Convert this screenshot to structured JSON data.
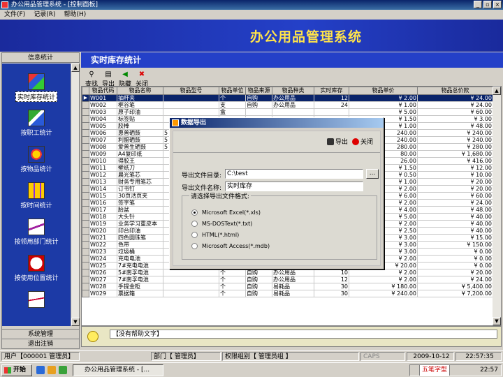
{
  "window": {
    "title": "办公用品管理系统 - [控制面板]"
  },
  "menu": [
    {
      "label": "文件(F)"
    },
    {
      "label": "记录(R)"
    },
    {
      "label": "帮助(H)"
    }
  ],
  "banner": {
    "title": "办公用品管理系统"
  },
  "sidebar": {
    "header": "信息统计",
    "items": [
      {
        "label": "实时库存统计",
        "icon": "cubes-icon",
        "selected": true
      },
      {
        "label": "按职工统计",
        "icon": "boxes-icon"
      },
      {
        "label": "按物品统计",
        "icon": "gears-icon"
      },
      {
        "label": "按时间统计",
        "icon": "grid-icon"
      },
      {
        "label": "按领用部门统计",
        "icon": "trend-chart-icon"
      },
      {
        "label": "按使用位置统计",
        "icon": "clock-icon"
      },
      {
        "label": "",
        "icon": "line-chart-icon"
      }
    ],
    "footer_system": "系统管理",
    "footer_logout": "退出注销"
  },
  "content": {
    "title": "实时库存统计",
    "toolbar": [
      {
        "label": "查找",
        "icon": "binoculars-icon"
      },
      {
        "label": "导出",
        "icon": "export-icon"
      },
      {
        "label": "隐藏",
        "icon": "arrow-left-icon"
      },
      {
        "label": "关闭",
        "icon": "close-icon"
      }
    ],
    "columns": [
      "物品代码",
      "物品名称",
      "物品型号",
      "物品单位",
      "物品来源",
      "物品种类",
      "实时库存",
      "物品单价",
      "物品总价款"
    ],
    "rows": [
      [
        "W001",
        "抽杆夹",
        "",
        "个",
        "自购",
        "办公用品",
        "12",
        "¥ 2.00",
        "¥ 24.00"
      ],
      [
        "W002",
        "框谷笔",
        "",
        "支",
        "自购",
        "办公用品",
        "24",
        "¥ 1.00",
        "¥ 24.00"
      ],
      [
        "W003",
        "原子印油",
        "",
        "盒",
        "",
        "",
        "",
        "¥ 5.00",
        "¥ 60.00"
      ],
      [
        "W004",
        "标签贴",
        "",
        "",
        "",
        "",
        "",
        "¥ 1.50",
        "¥ 3.00"
      ],
      [
        "W005",
        "胶棒",
        "",
        "",
        "",
        "",
        "",
        "¥ 1.00",
        "¥ 48.00"
      ],
      [
        "W006",
        "惠普硒鼓",
        "5",
        "",
        "",
        "",
        "",
        "240.00",
        "¥ 240.00"
      ],
      [
        "W007",
        "利盟硒鼓",
        "5",
        "",
        "",
        "",
        "",
        "240.00",
        "¥ 240.00"
      ],
      [
        "W008",
        "爱普生硒鼓",
        "5",
        "",
        "",
        "",
        "",
        "280.00",
        "¥ 280.00"
      ],
      [
        "W009",
        "A4复印纸",
        "",
        "",
        "",
        "",
        "",
        "80.00",
        "¥ 1,680.00"
      ],
      [
        "W010",
        "得胶王",
        "",
        "",
        "",
        "",
        "",
        "26.00",
        "¥ 416.00"
      ],
      [
        "W011",
        "壁纸刀",
        "",
        "",
        "",
        "",
        "",
        "¥ 1.50",
        "¥ 12.00"
      ],
      [
        "W012",
        "晨光笔芯",
        "",
        "",
        "",
        "",
        "",
        "¥ 0.50",
        "¥ 10.00"
      ],
      [
        "W013",
        "财务专用笔芯",
        "",
        "",
        "",
        "",
        "",
        "¥ 1.00",
        "¥ 20.00"
      ],
      [
        "W014",
        "订书钉",
        "",
        "",
        "",
        "",
        "",
        "¥ 2.00",
        "¥ 20.00"
      ],
      [
        "W015",
        "30页活页夹",
        "",
        "",
        "",
        "",
        "",
        "¥ 6.00",
        "¥ 60.00"
      ],
      [
        "W016",
        "签字笔",
        "",
        "",
        "",
        "",
        "",
        "¥ 2.00",
        "¥ 24.00"
      ],
      [
        "W017",
        "胎盆",
        "",
        "",
        "",
        "",
        "",
        "¥ 4.00",
        "¥ 48.00"
      ],
      [
        "W018",
        "大头针",
        "",
        "",
        "",
        "",
        "",
        "¥ 5.00",
        "¥ 40.00"
      ],
      [
        "W019",
        "业务学习重皮本",
        "",
        "",
        "",
        "",
        "",
        "¥ 2.00",
        "¥ 40.00"
      ],
      [
        "W020",
        "印台印油",
        "",
        "",
        "",
        "",
        "",
        "¥ 2.50",
        "¥ 40.00"
      ],
      [
        "W021",
        "四色圆珠笔",
        "",
        "",
        "",
        "",
        "",
        "¥ 3.00",
        "¥ 15.00"
      ],
      [
        "W022",
        "色带",
        "",
        "",
        "",
        "",
        "",
        "¥ 3.00",
        "¥ 150.00"
      ],
      [
        "W023",
        "垃圾桶",
        "",
        "个",
        "自购",
        "办公用品",
        "",
        "¥ 3.00",
        "¥ 0.00"
      ],
      [
        "W024",
        "充电电池",
        "",
        "个",
        "自购",
        "办公用品",
        "10",
        "¥ 2.00",
        "¥ 0.00"
      ],
      [
        "W025",
        "7#充电电池",
        "",
        "个",
        "自购",
        "办公用品",
        "6",
        "¥ 20.00",
        "¥ 0.00"
      ],
      [
        "W026",
        "5#南孚电池",
        "",
        "个",
        "自购",
        "办公用品",
        "10",
        "¥ 2.00",
        "¥ 20.00"
      ],
      [
        "W027",
        "7#南孚电池",
        "",
        "个",
        "自购",
        "办公用品",
        "12",
        "¥ 2.00",
        "¥ 24.00"
      ],
      [
        "W028",
        "手提金柜",
        "",
        "个",
        "自购",
        "易耗品",
        "30",
        "¥ 180.00",
        "¥ 5,400.00"
      ],
      [
        "W029",
        "票据箱",
        "",
        "个",
        "自购",
        "易耗品",
        "30",
        "¥ 240.00",
        "¥ 7,200.00"
      ]
    ],
    "help_text": "【没有帮助文字】"
  },
  "status": {
    "user": "用户【000001 管理员】",
    "dept": "部门【 管理员】",
    "perm": "权限组别【 管理员组 】",
    "caps": "CAPS",
    "date": "2009-10-12",
    "time": "22:57:35"
  },
  "taskbar": {
    "start": "开始",
    "app": "办公用品管理系统 - [...",
    "clock": "22:57",
    "ime": "五笔字型"
  },
  "dialog": {
    "title": "数据导出",
    "export_btn": "导出",
    "close_btn": "关闭",
    "dir_label": "导出文件目录:",
    "dir_value": "C:\\test",
    "browse": "...",
    "name_label": "导出文件名称:",
    "name_value": "实时库存",
    "format_group": "请选择导出文件格式:",
    "formats": [
      {
        "label": "Microsoft Excel(*.xls)",
        "checked": true
      },
      {
        "label": "MS-DOSText(*.txt)",
        "checked": false
      },
      {
        "label": "HTML(*.html)",
        "checked": false
      },
      {
        "label": "Microsoft Access(*.mdb)",
        "checked": false
      }
    ]
  }
}
